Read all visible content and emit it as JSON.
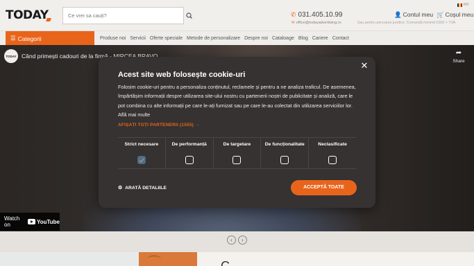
{
  "header": {
    "logo": "TODAY",
    "search_placeholder": "Ce vrei sa cauți?",
    "phone": "031.405.10.99",
    "email": "office@todayadvertising.ro",
    "account_label": "Contul meu",
    "cart_label": "Coșul meu",
    "shipping_note": "Sau pentru persoane juridice: Comandă minimă €300 + TVA",
    "language": "RO"
  },
  "nav": {
    "categories_label": "Categorii",
    "links": [
      "Produse noi",
      "Servicii",
      "Oferte speciale",
      "Metode de personalizare",
      "Despre noi",
      "Cataloage",
      "Blog",
      "Cariere",
      "Contact"
    ]
  },
  "video": {
    "channel_avatar": "TODAY",
    "title": "Când primești cadouri de la firmă - MIRCEA BRAVO",
    "share_label": "Share",
    "watch_on_label": "Watch on",
    "youtube_label": "YouTube"
  },
  "cookie_modal": {
    "title": "Acest site web folosește cookie-uri",
    "description": "Folosim cookie-uri pentru a personaliza conținutul, reclamele și pentru a ne analiza traficul. De asemenea, împărtășim informații despre utilizarea site-ului nostru cu partenerii noștri de publicitate și analiză, care le pot combina cu alte informații pe care le-ați furnizat sau pe care le-au colectat din utilizarea serviciilor lor. Află mai multe",
    "partners_link": "AFIȘAȚI TOȚI PARTENERII (1555) →",
    "categories": [
      {
        "label": "Strict necesare",
        "checked": true
      },
      {
        "label": "De performanță",
        "checked": false
      },
      {
        "label": "De targetare",
        "checked": false
      },
      {
        "label": "De funcționalitate",
        "checked": false
      },
      {
        "label": "Neclasificate",
        "checked": false
      }
    ],
    "details_label": "ARATĂ DETALIILE",
    "accept_label": "ACCEPTĂ TOATE"
  },
  "promo": {
    "heading": "C"
  },
  "colors": {
    "accent": "#e8641b",
    "modal_bg": "#353231",
    "header_bg": "#f1efec"
  }
}
